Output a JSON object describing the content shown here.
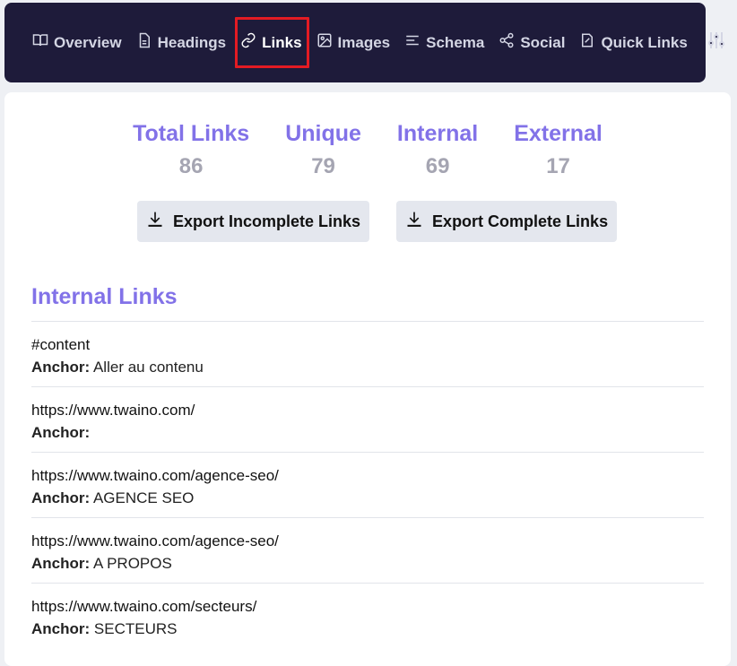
{
  "nav": {
    "items": [
      {
        "label": "Overview",
        "icon": "book-icon"
      },
      {
        "label": "Headings",
        "icon": "document-icon"
      },
      {
        "label": "Links",
        "icon": "link-icon",
        "active": true
      },
      {
        "label": "Images",
        "icon": "image-icon"
      },
      {
        "label": "Schema",
        "icon": "list-icon"
      },
      {
        "label": "Social",
        "icon": "share-icon"
      },
      {
        "label": "Quick Links",
        "icon": "bookmark-icon"
      }
    ],
    "settings_icon": "sliders-icon"
  },
  "stats": [
    {
      "label": "Total Links",
      "value": "86"
    },
    {
      "label": "Unique",
      "value": "79"
    },
    {
      "label": "Internal",
      "value": "69"
    },
    {
      "label": "External",
      "value": "17"
    }
  ],
  "buttons": {
    "export_incomplete": "Export Incomplete Links",
    "export_complete": "Export Complete Links"
  },
  "section": {
    "title": "Internal Links"
  },
  "anchor_label": "Anchor:",
  "links": [
    {
      "url": "#content",
      "anchor": "Aller au contenu"
    },
    {
      "url": "https://www.twaino.com/",
      "anchor": ""
    },
    {
      "url": "https://www.twaino.com/agence-seo/",
      "anchor": "AGENCE SEO"
    },
    {
      "url": "https://www.twaino.com/agence-seo/",
      "anchor": "A PROPOS"
    },
    {
      "url": "https://www.twaino.com/secteurs/",
      "anchor": "SECTEURS"
    }
  ],
  "colors": {
    "navbar": "#1e1b3a",
    "accent": "#8272e8",
    "highlight": "#e31b23"
  }
}
